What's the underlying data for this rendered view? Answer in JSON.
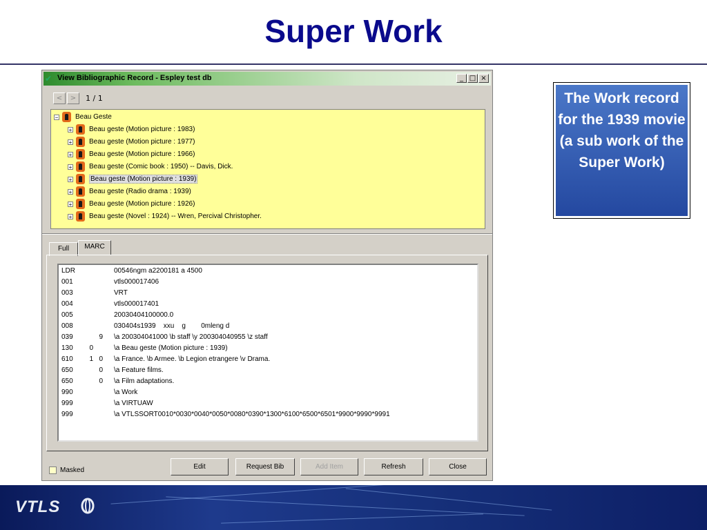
{
  "slide": {
    "title": "Super Work"
  },
  "window": {
    "title": "View Bibliographic Record - Espley test db",
    "controls": {
      "minimize": "_",
      "maximize": "□",
      "close": "×"
    },
    "nav": {
      "prev": "<",
      "next": ">",
      "counter": "1 / 1"
    },
    "tree": {
      "root": "Beau Geste",
      "children": [
        "Beau geste (Motion picture : 1983)",
        "Beau geste (Motion picture : 1977)",
        "Beau geste (Motion picture : 1966)",
        "Beau geste (Comic book : 1950) -- Davis, Dick.",
        "Beau geste (Motion picture : 1939)",
        "Beau geste (Radio drama : 1939)",
        "Beau geste (Motion picture : 1926)",
        "Beau geste (Novel : 1924) -- Wren, Percival Christopher."
      ],
      "selected_index": 4
    },
    "tabs": [
      "Full",
      "MARC"
    ],
    "active_tab": "MARC",
    "marc": [
      {
        "tag": "LDR",
        "i1": "",
        "i2": "",
        "value": "00546ngm a2200181 a 4500"
      },
      {
        "tag": "001",
        "i1": "",
        "i2": "",
        "value": "vtls000017406"
      },
      {
        "tag": "003",
        "i1": "",
        "i2": "",
        "value": "VRT"
      },
      {
        "tag": "004",
        "i1": "",
        "i2": "",
        "value": "vtls000017401"
      },
      {
        "tag": "005",
        "i1": "",
        "i2": "",
        "value": "20030404100000.0"
      },
      {
        "tag": "008",
        "i1": "",
        "i2": "",
        "value": "030404s1939    xxu    g        0mleng d"
      },
      {
        "tag": "039",
        "i1": "",
        "i2": "9",
        "value": "\\a 200304041000 \\b staff \\y 200304040955 \\z staff"
      },
      {
        "tag": "130",
        "i1": "0",
        "i2": "",
        "value": "\\a Beau geste (Motion picture : 1939)"
      },
      {
        "tag": "610",
        "i1": "1",
        "i2": "0",
        "value": "\\a France. \\b Armee. \\b Legion etrangere \\v Drama."
      },
      {
        "tag": "650",
        "i1": "",
        "i2": "0",
        "value": "\\a Feature films."
      },
      {
        "tag": "650",
        "i1": "",
        "i2": "0",
        "value": "\\a Film adaptations."
      },
      {
        "tag": "990",
        "i1": "",
        "i2": "",
        "value": "\\a Work"
      },
      {
        "tag": "999",
        "i1": "",
        "i2": "",
        "value": "\\a VIRTUAW"
      },
      {
        "tag": "999",
        "i1": "",
        "i2": "",
        "value": "\\a VTLSSORT0010*0030*0040*0050*0080*0390*1300*6100*6500*6501*9900*9990*9991"
      }
    ],
    "masked_label": "Masked",
    "buttons": {
      "edit": "Edit",
      "request_bib": "Request Bib",
      "add_item": "Add Item",
      "refresh": "Refresh",
      "close": "Close"
    }
  },
  "callout": {
    "text": "The Work record for the 1939 movie (a sub work of the Super Work)"
  },
  "footer": {
    "logo": "VTLS"
  },
  "colors": {
    "title": "#0a0a8c",
    "tree_bg": "#ffff99",
    "callout_bg": "#2f56ad",
    "footer_bg": "#16307a"
  }
}
